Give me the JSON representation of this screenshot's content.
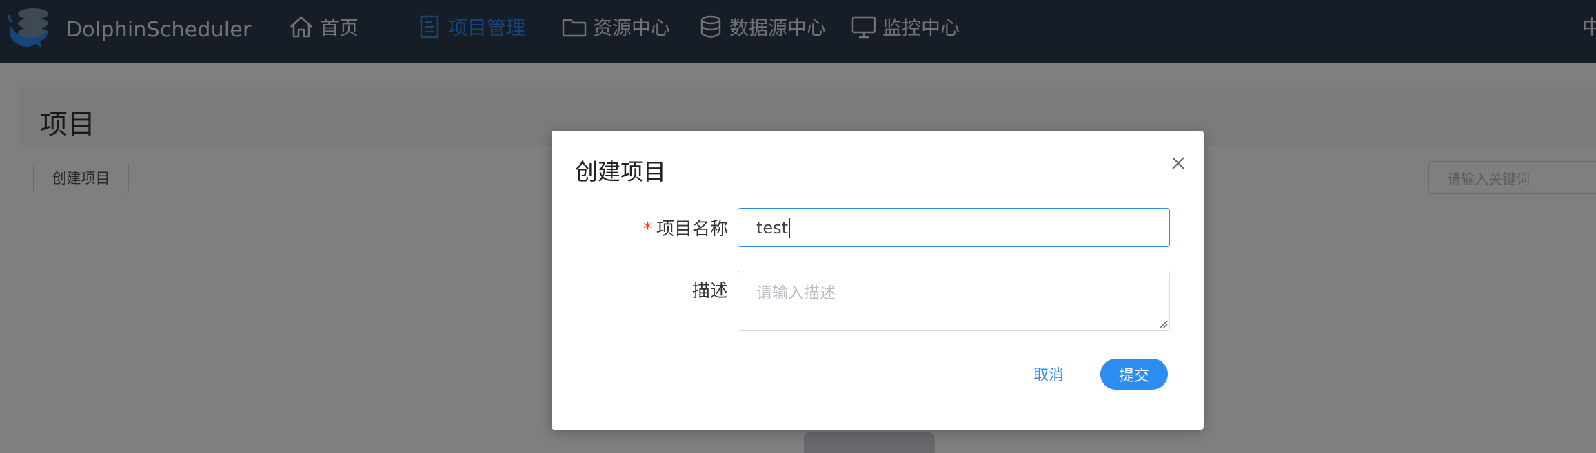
{
  "brand": {
    "name": "DolphinScheduler",
    "logo_icon": "dolphin-logo-icon"
  },
  "nav": {
    "items": [
      {
        "label": "首页",
        "icon": "home-icon"
      },
      {
        "label": "项目管理",
        "icon": "document-icon",
        "active": true
      },
      {
        "label": "资源中心",
        "icon": "folder-icon"
      },
      {
        "label": "数据源中心",
        "icon": "database-icon"
      },
      {
        "label": "监控中心",
        "icon": "monitor-icon"
      }
    ],
    "language": "中"
  },
  "page": {
    "title": "项目",
    "create_button": "创建项目",
    "search_placeholder": "请输入关键词"
  },
  "modal": {
    "title": "创建项目",
    "name_label": "项目名称",
    "required_mark": "*",
    "name_value": "test",
    "desc_label": "描述",
    "desc_placeholder": "请输入描述",
    "cancel_label": "取消",
    "submit_label": "提交"
  },
  "colors": {
    "nav_bg": "#2f3a4d",
    "accent": "#2d8cf0",
    "required": "#ed3f14",
    "overlay": "rgba(0,0,0,0.5)"
  }
}
